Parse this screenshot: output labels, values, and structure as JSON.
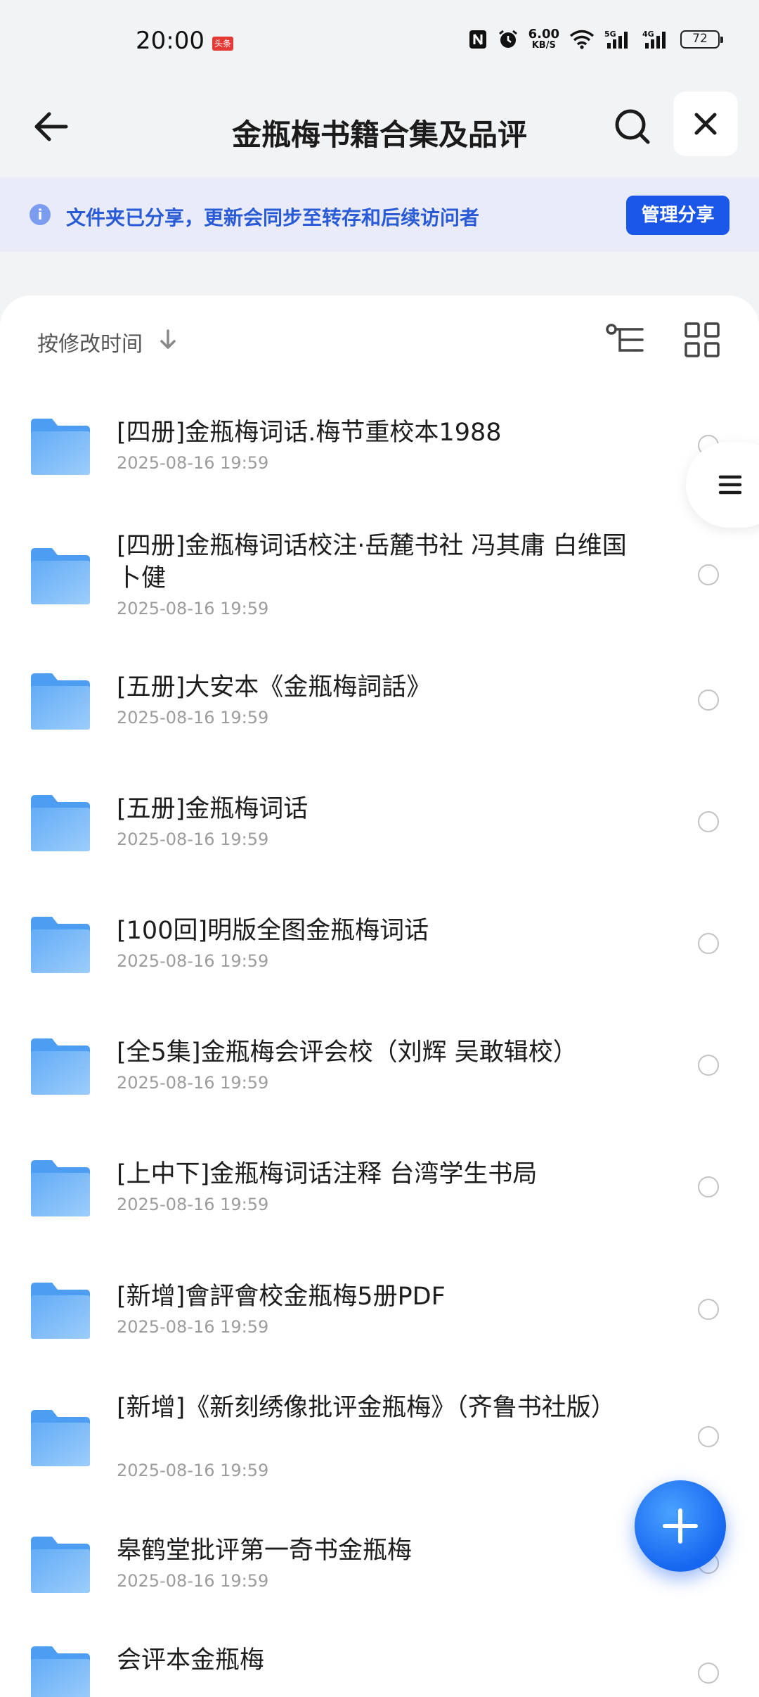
{
  "status_bar": {
    "time": "20:00",
    "news_badge": "头条",
    "net_speed_value": "6.00",
    "net_speed_unit": "KB/S",
    "signal_1": "5G",
    "signal_2": "4G",
    "battery": "72"
  },
  "header": {
    "title": "金瓶梅书籍合集及品评"
  },
  "share_banner": {
    "text": "文件夹已分享，更新会同步至转存和后续访问者",
    "button": "管理分享"
  },
  "toolbar": {
    "sort_label": "按修改时间"
  },
  "files": [
    {
      "name": "[四册]金瓶梅词话.梅节重校本1988",
      "date": "2025-08-16 19:59"
    },
    {
      "name": "[四册]金瓶梅词话校注·岳麓书社 冯其庸 白维国卜健",
      "date": "2025-08-16 19:59"
    },
    {
      "name": "[五册]大安本《金瓶梅詞話》",
      "date": "2025-08-16 19:59"
    },
    {
      "name": "[五册]金瓶梅词话",
      "date": "2025-08-16 19:59"
    },
    {
      "name": "[100回]明版全图金瓶梅词话",
      "date": "2025-08-16 19:59"
    },
    {
      "name": "[全5集]金瓶梅会评会校（刘辉 吴敢辑校）",
      "date": "2025-08-16 19:59"
    },
    {
      "name": "[上中下]金瓶梅词话注释 台湾学生书局",
      "date": "2025-08-16 19:59"
    },
    {
      "name": "[新增]會評會校金瓶梅5册PDF",
      "date": "2025-08-16 19:59"
    },
    {
      "name": "[新增]《新刻绣像批评金瓶梅》（齐鲁书社版）",
      "date": "2025-08-16 19:59"
    },
    {
      "name": "皋鹤堂批评第一奇书金瓶梅",
      "date": "2025-08-16 19:59"
    },
    {
      "name": "会评本金瓶梅",
      "date": ""
    }
  ],
  "colors": {
    "accent": "#1a57e8",
    "banner_bg": "#e9ecf8",
    "banner_text": "#2a5bd7",
    "folder": "#5aa8f5"
  }
}
